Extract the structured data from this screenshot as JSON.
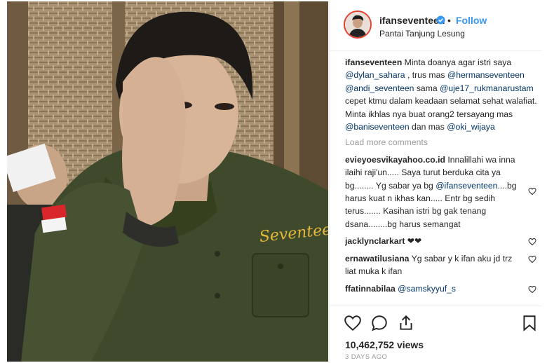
{
  "header": {
    "username": "ifanseventeen",
    "separator": "•",
    "follow_label": "Follow",
    "location": "Pantai Tanjung Lesung"
  },
  "caption": {
    "user": "ifanseventeen",
    "t1": " Minta doanya agar istri saya ",
    "m1": "@dylan_sahara",
    "t2": " , trus mas ",
    "m2": "@hermanseventeen",
    "t3": " ",
    "m3": "@andi_seventeen",
    "t4": " sama ",
    "m4": "@uje17_rukmanarustam",
    "t5": " cepet ktmu dalam keadaan selamat sehat walafiat. Minta ikhlas nya buat orang2 tersayang mas ",
    "m5": "@baniseventeen",
    "t6": " dan mas ",
    "m6": "@oki_wijaya"
  },
  "load_more_label": "Load more comments",
  "comments": [
    {
      "user": "evieyoesvikayahoo.co.id",
      "t1": " Innalillahi wa inna ilaihi raji'un..... Saya turut berduka cita ya bg........ Yg sabar ya bg ",
      "m1": "@ifanseventeen",
      "t2": "....bg harus kuat n ikhas kan..... Entr bg sedih terus....... Kasihan istri bg gak tenang dsana........bg harus semangat"
    },
    {
      "user": "jacklynclarkart",
      "text": " ❤❤"
    },
    {
      "user": "ernawatilusiana",
      "text": " Yg sabar y k ifan aku jd trz liat muka k ifan"
    },
    {
      "user": "ffatinnabilaa",
      "m1": "@samskyyuf_s"
    }
  ],
  "post": {
    "views": "10,462,752 views",
    "date": "3 DAYS AGO"
  },
  "photo_text": {
    "jacket_embroidery": "Seventeen"
  },
  "colors": {
    "link_blue": "#3897f0",
    "mention_blue": "#003569",
    "muted_gray": "#999999",
    "text": "#262626",
    "verified": "#3897f0"
  },
  "icons": [
    "verified-badge-icon",
    "heart-icon",
    "comment-icon",
    "share-icon",
    "bookmark-icon"
  ]
}
